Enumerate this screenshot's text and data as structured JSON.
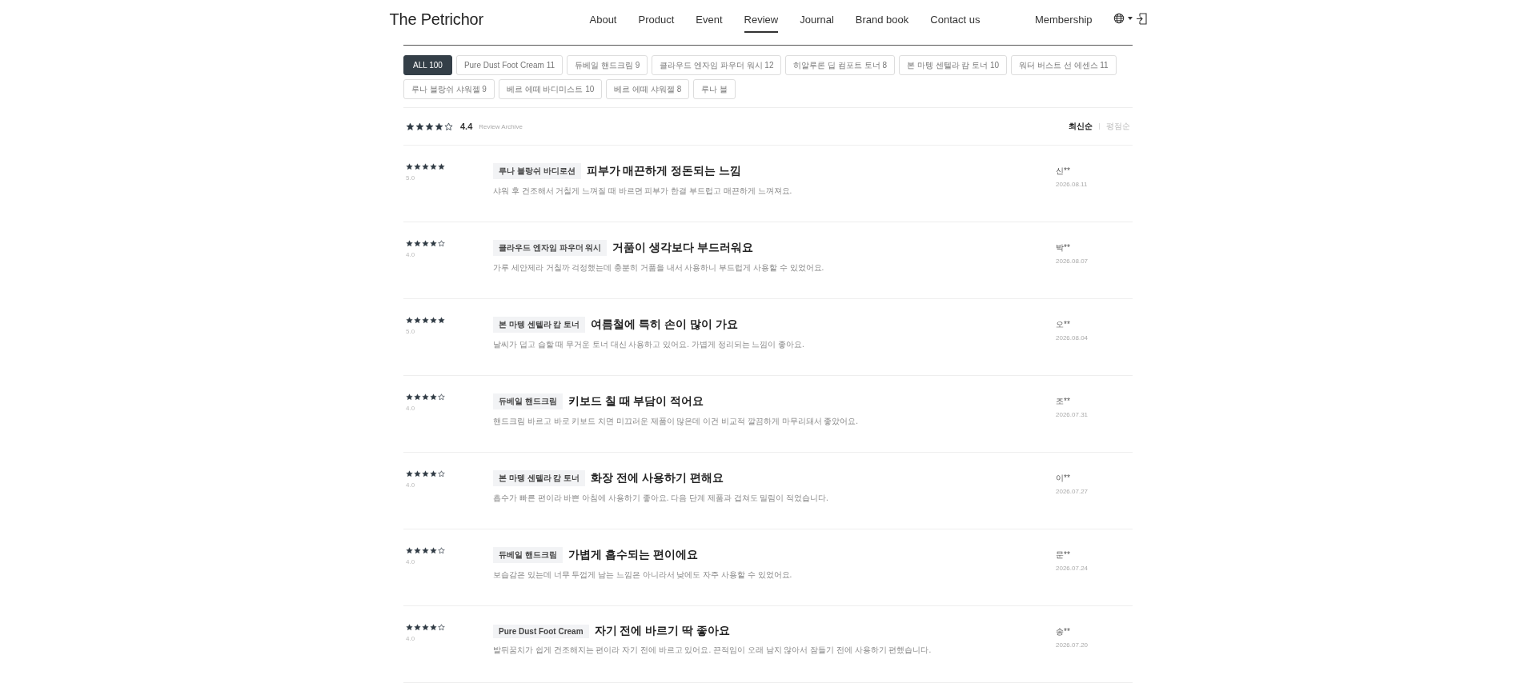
{
  "header": {
    "logo": "The Petrichor",
    "membership": "Membership",
    "nav": [
      {
        "label": "About",
        "selected": false
      },
      {
        "label": "Product",
        "selected": false
      },
      {
        "label": "Event",
        "selected": false
      },
      {
        "label": "Review",
        "selected": true
      },
      {
        "label": "Journal",
        "selected": false
      },
      {
        "label": "Brand book",
        "selected": false
      },
      {
        "label": "Contact us",
        "selected": false
      }
    ]
  },
  "filters": [
    {
      "label": "ALL 100",
      "selected": true
    },
    {
      "label": "Pure Dust Foot Cream 11",
      "selected": false
    },
    {
      "label": "듀베일 핸드크림 9",
      "selected": false
    },
    {
      "label": "클라우드 엔자임 파우더 워시 12",
      "selected": false
    },
    {
      "label": "히알루론 딥 컴포트 토너 8",
      "selected": false
    },
    {
      "label": "본 마텡 센텔라 캄 토너 10",
      "selected": false
    },
    {
      "label": "워터 버스트 선 에센스 11",
      "selected": false
    },
    {
      "label": "루나 블랑쉬 샤워젤 9",
      "selected": false
    },
    {
      "label": "베르 에떼 바디미스트 10",
      "selected": false
    },
    {
      "label": "베르 에떼 샤워젤 8",
      "selected": false
    },
    {
      "label": "루나 블",
      "selected": false
    }
  ],
  "summary": {
    "stars": 4,
    "rating": "4.4",
    "caption": "Review Archive",
    "sort": [
      {
        "label": "최신순",
        "selected": true
      },
      {
        "label": "평점순",
        "selected": false
      }
    ]
  },
  "reviews": [
    {
      "stars": 5,
      "rating": "5.0",
      "product": "루나 블랑쉬 바디로션",
      "title": "피부가 매끈하게 정돈되는 느낌",
      "body": "샤워 후 건조해서 거칠게 느껴질 때 바르면 피부가 한결 부드럽고 매끈하게 느껴져요.",
      "author": "신**",
      "date": "2026.08.11"
    },
    {
      "stars": 4,
      "rating": "4.0",
      "product": "클라우드 엔자임 파우더 워시",
      "title": "거품이 생각보다 부드러워요",
      "body": "가루 세안제라 거칠까 걱정했는데 충분히 거품을 내서 사용하니 부드럽게 사용할 수 있었어요.",
      "author": "박**",
      "date": "2026.08.07"
    },
    {
      "stars": 5,
      "rating": "5.0",
      "product": "본 마텡 센텔라 캄 토너",
      "title": "여름철에 특히 손이 많이 가요",
      "body": "날씨가 덥고 습할 때 무거운 토너 대신 사용하고 있어요. 가볍게 정리되는 느낌이 좋아요.",
      "author": "오**",
      "date": "2026.08.04"
    },
    {
      "stars": 4,
      "rating": "4.0",
      "product": "듀베일 핸드크림",
      "title": "키보드 칠 때 부담이 적어요",
      "body": "핸드크림 바르고 바로 키보드 치면 미끄러운 제품이 많은데 이건 비교적 깔끔하게 마무리돼서 좋았어요.",
      "author": "조**",
      "date": "2026.07.31"
    },
    {
      "stars": 4,
      "rating": "4.0",
      "product": "본 마텡 센텔라 캄 토너",
      "title": "화장 전에 사용하기 편해요",
      "body": "흡수가 빠른 편이라 바쁜 아침에 사용하기 좋아요. 다음 단계 제품과 겹쳐도 밀림이 적었습니다.",
      "author": "이**",
      "date": "2026.07.27"
    },
    {
      "stars": 4,
      "rating": "4.0",
      "product": "듀베일 핸드크림",
      "title": "가볍게 흡수되는 편이에요",
      "body": "보습감은 있는데 너무 두껍게 남는 느낌은 아니라서 낮에도 자주 사용할 수 있었어요.",
      "author": "문**",
      "date": "2026.07.24"
    },
    {
      "stars": 4,
      "rating": "4.0",
      "product": "Pure Dust Foot Cream",
      "title": "자기 전에 바르기 딱 좋아요",
      "body": "발뒤꿈치가 쉽게 건조해지는 편이라 자기 전에 바르고 있어요. 끈적임이 오래 남지 않아서 잠들기 전에 사용하기 편했습니다.",
      "author": "송**",
      "date": "2026.07.20"
    }
  ]
}
